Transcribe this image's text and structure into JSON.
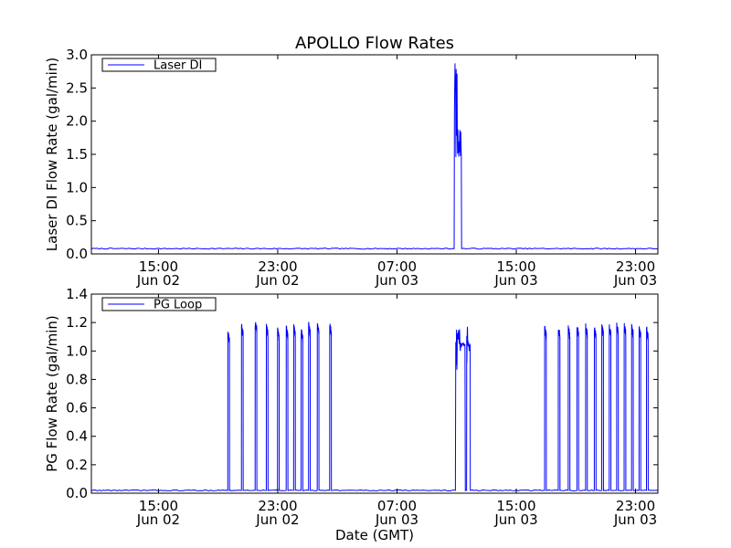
{
  "chart_data": {
    "title": "APOLLO Flow Rates",
    "x_axis_label": "Date (GMT)",
    "x_range": [
      "2012-06-02T10:30",
      "2012-06-04T00:30"
    ],
    "x_ticks": [
      {
        "time": "2012-06-02T15:00",
        "label_time": "15:00",
        "label_date": "Jun 02"
      },
      {
        "time": "2012-06-02T23:00",
        "label_time": "23:00",
        "label_date": "Jun 02"
      },
      {
        "time": "2012-06-03T07:00",
        "label_time": "07:00",
        "label_date": "Jun 03"
      },
      {
        "time": "2012-06-03T15:00",
        "label_time": "15:00",
        "label_date": "Jun 03"
      },
      {
        "time": "2012-06-03T23:00",
        "label_time": "23:00",
        "label_date": "Jun 03"
      }
    ],
    "panels": [
      {
        "type": "line",
        "ylabel": "Laser DI Flow Rate (gal/min)",
        "ylim": [
          0.0,
          3.0
        ],
        "y_ticks": [
          "0.0",
          "0.5",
          "1.0",
          "1.5",
          "2.0",
          "2.5",
          "3.0"
        ],
        "legend": "top-left",
        "baseline": 0.08,
        "series": [
          {
            "name": "Laser DI",
            "color": "#0000ff"
          }
        ],
        "bursts": [
          {
            "start": "2012-06-03T10:50",
            "end": "2012-06-03T11:20",
            "peak": 2.95,
            "mid": 1.45
          }
        ]
      },
      {
        "type": "line",
        "ylabel": "PG Flow Rate (gal/min)",
        "ylim": [
          0.0,
          1.4
        ],
        "y_ticks": [
          "0.0",
          "0.2",
          "0.4",
          "0.6",
          "0.8",
          "1.0",
          "1.2",
          "1.4"
        ],
        "legend": "top-left",
        "baseline": 0.02,
        "series": [
          {
            "name": "PG Loop",
            "color": "#0000ff"
          }
        ],
        "pulses": [
          {
            "time": "2012-06-02T19:40",
            "peak": 1.13
          },
          {
            "time": "2012-06-02T20:35",
            "peak": 1.17
          },
          {
            "time": "2012-06-02T21:30",
            "peak": 1.2
          },
          {
            "time": "2012-06-02T22:15",
            "peak": 1.17
          },
          {
            "time": "2012-06-02T23:00",
            "peak": 1.15
          },
          {
            "time": "2012-06-02T23:35",
            "peak": 1.16
          },
          {
            "time": "2012-06-03T00:05",
            "peak": 1.17
          },
          {
            "time": "2012-06-03T00:35",
            "peak": 1.14
          },
          {
            "time": "2012-06-03T01:05",
            "peak": 1.18
          },
          {
            "time": "2012-06-03T01:40",
            "peak": 1.18
          },
          {
            "time": "2012-06-03T02:30",
            "peak": 1.18
          },
          {
            "time": "2012-06-03T16:55",
            "peak": 1.16
          },
          {
            "time": "2012-06-03T17:50",
            "peak": 1.16
          },
          {
            "time": "2012-06-03T18:30",
            "peak": 1.16
          },
          {
            "time": "2012-06-03T19:05",
            "peak": 1.17
          },
          {
            "time": "2012-06-03T19:40",
            "peak": 1.17
          },
          {
            "time": "2012-06-03T20:15",
            "peak": 1.16
          },
          {
            "time": "2012-06-03T20:45",
            "peak": 1.17
          },
          {
            "time": "2012-06-03T21:15",
            "peak": 1.17
          },
          {
            "time": "2012-06-03T21:45",
            "peak": 1.18
          },
          {
            "time": "2012-06-03T22:15",
            "peak": 1.18
          },
          {
            "time": "2012-06-03T22:45",
            "peak": 1.17
          },
          {
            "time": "2012-06-03T23:15",
            "peak": 1.16
          },
          {
            "time": "2012-06-03T23:45",
            "peak": 1.15
          }
        ],
        "bursts": [
          {
            "start": "2012-06-03T10:55",
            "end": "2012-06-03T11:35",
            "peak": 1.18,
            "mid": 1.0
          },
          {
            "start": "2012-06-03T11:40",
            "end": "2012-06-03T11:55",
            "peak": 1.19,
            "mid": 1.0
          }
        ]
      }
    ]
  }
}
